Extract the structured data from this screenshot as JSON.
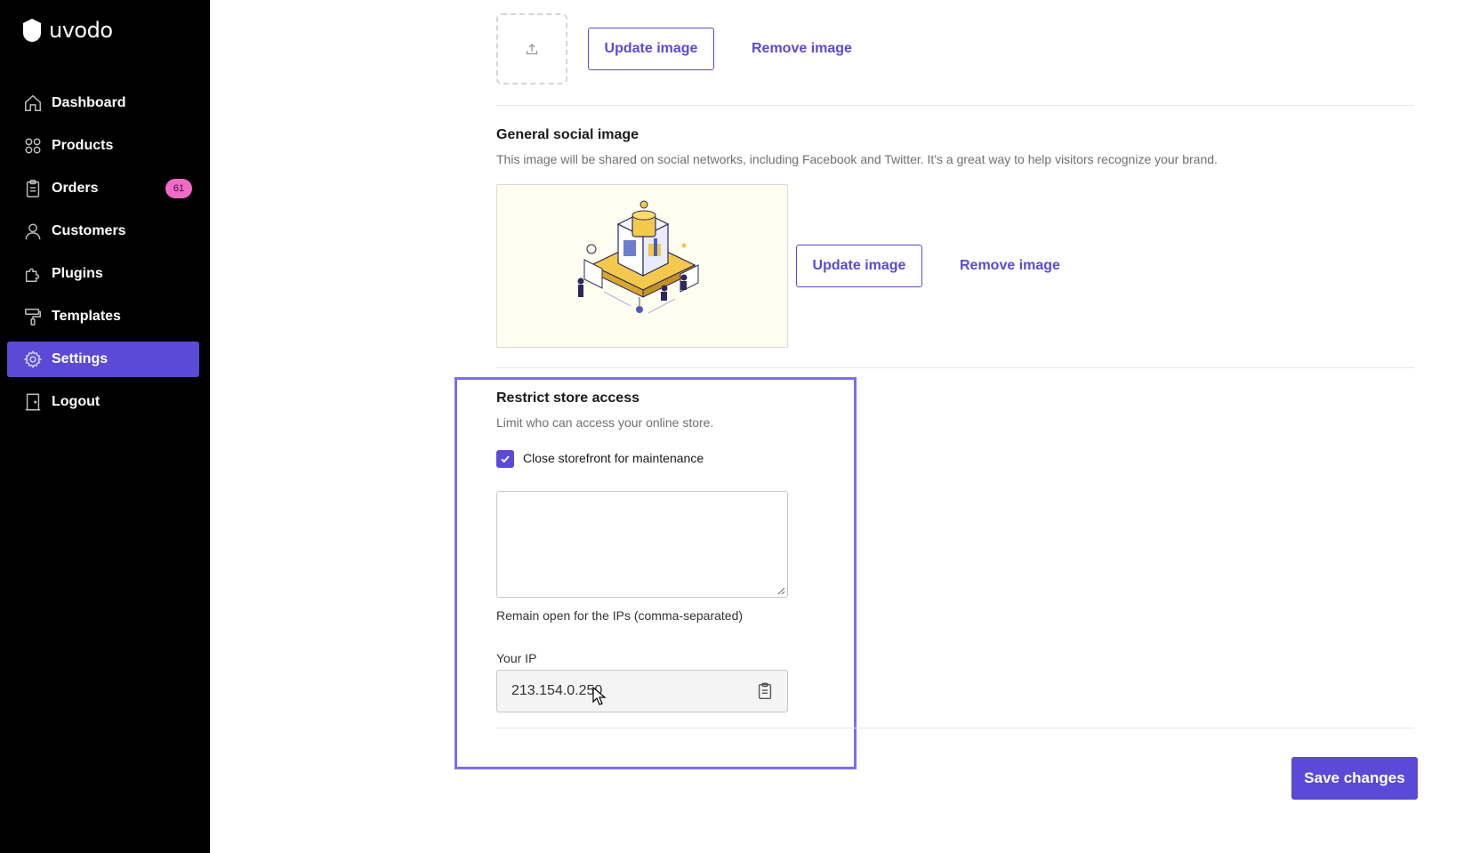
{
  "brand": {
    "name": "uvodo"
  },
  "sidebar": {
    "items": [
      {
        "label": "Dashboard",
        "icon": "home-icon"
      },
      {
        "label": "Products",
        "icon": "grid-icon"
      },
      {
        "label": "Orders",
        "icon": "clipboard-icon",
        "badge": "61"
      },
      {
        "label": "Customers",
        "icon": "user-icon"
      },
      {
        "label": "Plugins",
        "icon": "puzzle-icon"
      },
      {
        "label": "Templates",
        "icon": "paint-roller-icon"
      },
      {
        "label": "Settings",
        "icon": "gear-icon",
        "active": true
      },
      {
        "label": "Logout",
        "icon": "door-icon"
      }
    ]
  },
  "favicon_section": {
    "update_label": "Update image",
    "remove_label": "Remove image"
  },
  "social_image": {
    "title": "General social image",
    "description": "This image will be shared on social networks, including Facebook and Twitter. It's a great way to help visitors recognize your brand.",
    "update_label": "Update image",
    "remove_label": "Remove image"
  },
  "restrict_access": {
    "title": "Restrict store access",
    "description": "Limit who can access your online store.",
    "checkbox_label": "Close storefront for maintenance",
    "checkbox_checked": true,
    "ips_value": "",
    "ips_help": "Remain open for the IPs (comma-separated)",
    "your_ip_label": "Your IP",
    "your_ip_value": "213.154.0.250"
  },
  "actions": {
    "save_label": "Save changes"
  },
  "colors": {
    "accent": "#5b4ad7",
    "badge": "#f06ac7",
    "sidebar_bg": "#000000",
    "highlight": "#7b6ef0"
  }
}
